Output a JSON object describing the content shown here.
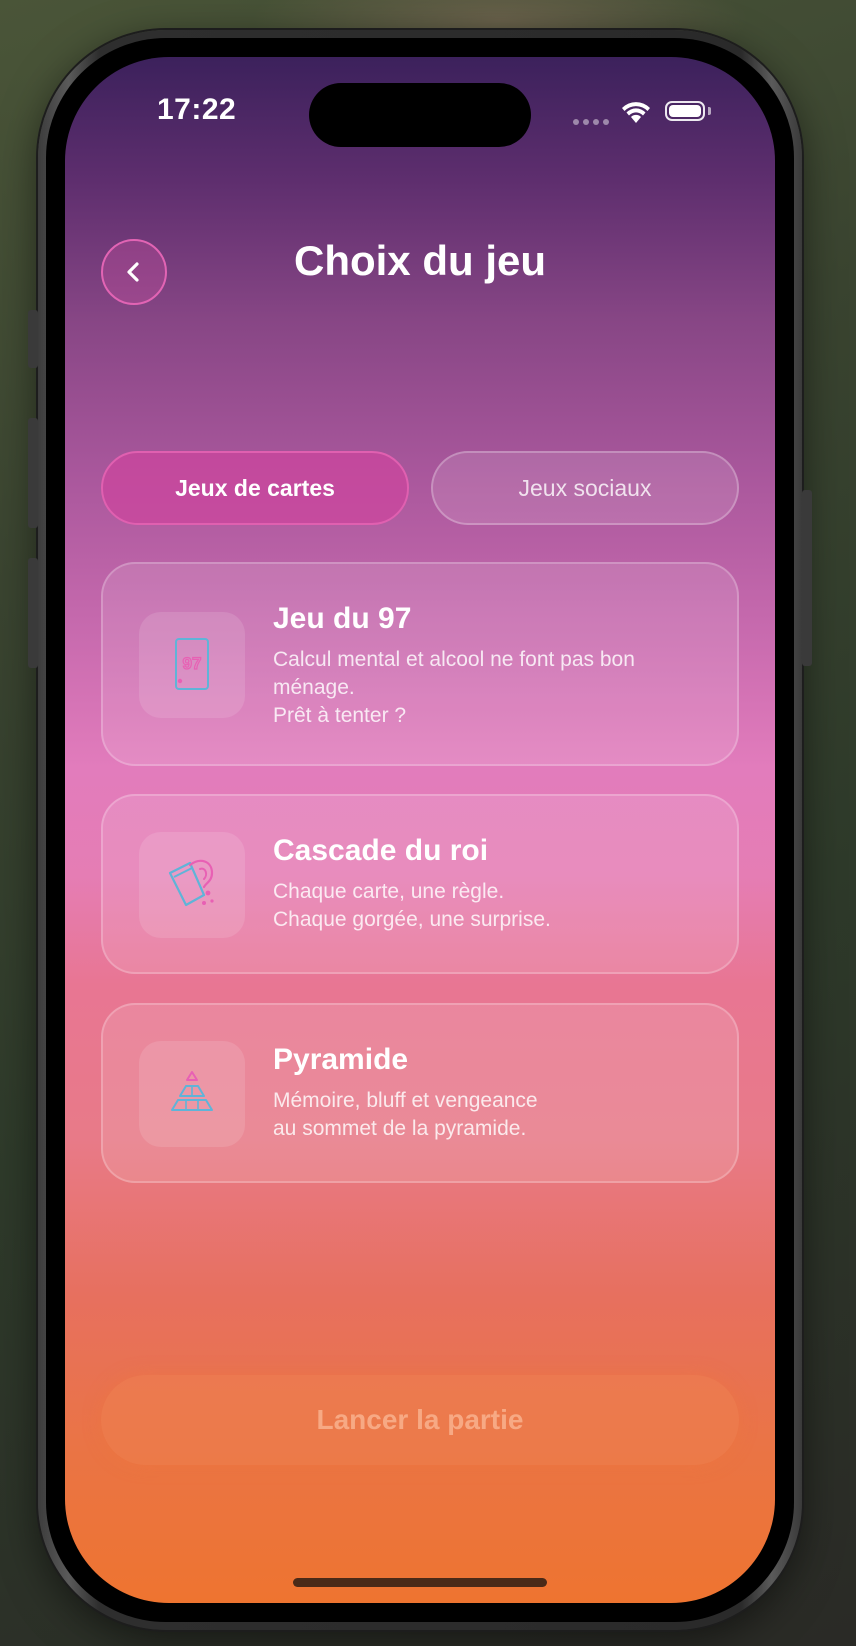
{
  "status_bar": {
    "time": "17:22"
  },
  "header": {
    "title": "Choix du jeu",
    "back_icon": "chevron-left-icon"
  },
  "tabs": [
    {
      "label": "Jeux de cartes",
      "selected": true
    },
    {
      "label": "Jeux sociaux",
      "selected": false
    }
  ],
  "games": [
    {
      "title": "Jeu du 97",
      "icon": "card-97-icon",
      "description": [
        "Calcul mental et alcool ne font pas bon",
        "ménage.",
        "Prêt à tenter ?"
      ]
    },
    {
      "title": "Cascade du roi",
      "icon": "spilling-glass-icon",
      "description": [
        "Chaque carte, une règle.",
        "Chaque gorgée, une surprise."
      ]
    },
    {
      "title": "Pyramide",
      "icon": "pyramid-icon",
      "description": [
        "Mémoire, bluff et vengeance",
        "au sommet de la pyramide."
      ]
    }
  ],
  "launch_button": {
    "label": "Lancer la partie",
    "enabled": false
  },
  "colors": {
    "accent_pink": "#e060b0",
    "gradient_top": "#3c215c",
    "gradient_bottom": "#ee7430"
  }
}
